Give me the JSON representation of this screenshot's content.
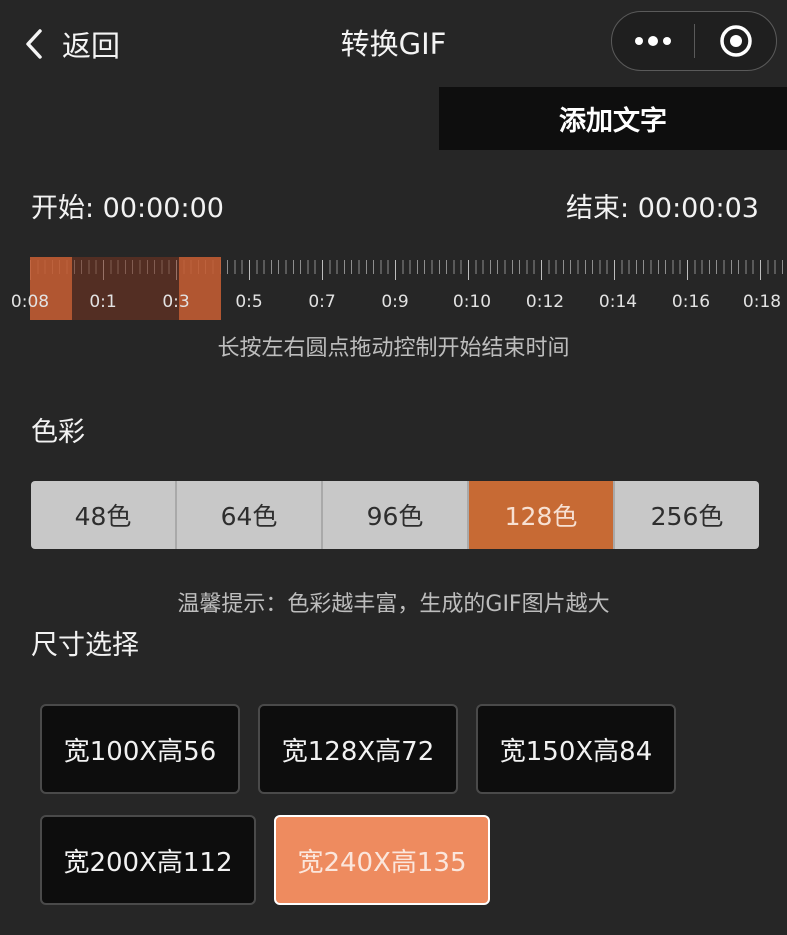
{
  "nav": {
    "back_label": "返回",
    "title": "转换GIF"
  },
  "toolbar": {
    "add_text_label": "添加文字"
  },
  "time": {
    "start_label": "开始: 00:00:00",
    "end_label": "结束: 00:00:03"
  },
  "timeline": {
    "tick_labels": [
      "0:08",
      "0:1",
      "0:3",
      "0:5",
      "0:7",
      "0:9",
      "0:10",
      "0:12",
      "0:14",
      "0:16",
      "0:18"
    ],
    "hint": "长按左右圆点拖动控制开始结束时间"
  },
  "color": {
    "title": "色彩",
    "options": [
      "48色",
      "64色",
      "96色",
      "128色",
      "256色"
    ],
    "selected": "128色",
    "hint": "温馨提示：色彩越丰富，生成的GIF图片越大"
  },
  "size": {
    "title": "尺寸选择",
    "options": [
      "宽100X高56",
      "宽128X高72",
      "宽150X高84",
      "宽200X高112",
      "宽240X高135"
    ],
    "selected": "宽240X高135"
  },
  "colors": {
    "background": "#262626",
    "accent": "#c76a34",
    "selected_size": "#ee8b5f"
  }
}
